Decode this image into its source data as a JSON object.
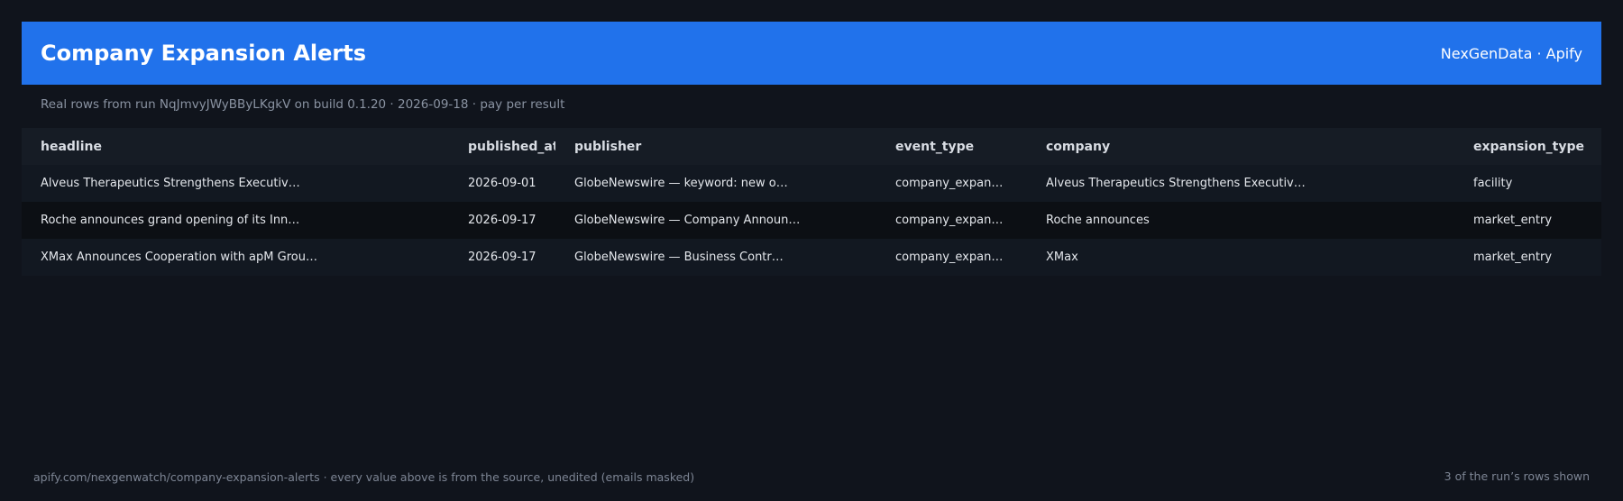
{
  "header": {
    "title": "Company Expansion Alerts",
    "brand": "NexGenData · Apify"
  },
  "subtitle": "Real rows from run NqJmvyJWyBByLKgkV on build 0.1.20 · 2026-09-18 · pay per result",
  "table": {
    "columns": [
      "headline",
      "published_at",
      "publisher",
      "event_type",
      "company",
      "expansion_type"
    ],
    "rows": [
      [
        "Alveus Therapeutics Strengthens Executiv…",
        "2026-09-01",
        "GlobeNewswire — keyword: new o…",
        "company_expan…",
        "Alveus Therapeutics Strengthens Executiv…",
        "facility"
      ],
      [
        "Roche announces grand opening of its Inn…",
        "2026-09-17",
        "GlobeNewswire — Company Announ…",
        "company_expan…",
        "Roche announces",
        "market_entry"
      ],
      [
        "XMax Announces Cooperation with apM Grou…",
        "2026-09-17",
        "GlobeNewswire — Business Contr…",
        "company_expan…",
        "XMax",
        "market_entry"
      ]
    ]
  },
  "footer": {
    "source": "apify.com/nexgenwatch/company-expansion-alerts  ·  every value above is from the source, unedited (emails masked)",
    "count": "3 of the run’s rows shown"
  },
  "colors": {
    "background": "#10141c",
    "header": "#2172eb"
  }
}
